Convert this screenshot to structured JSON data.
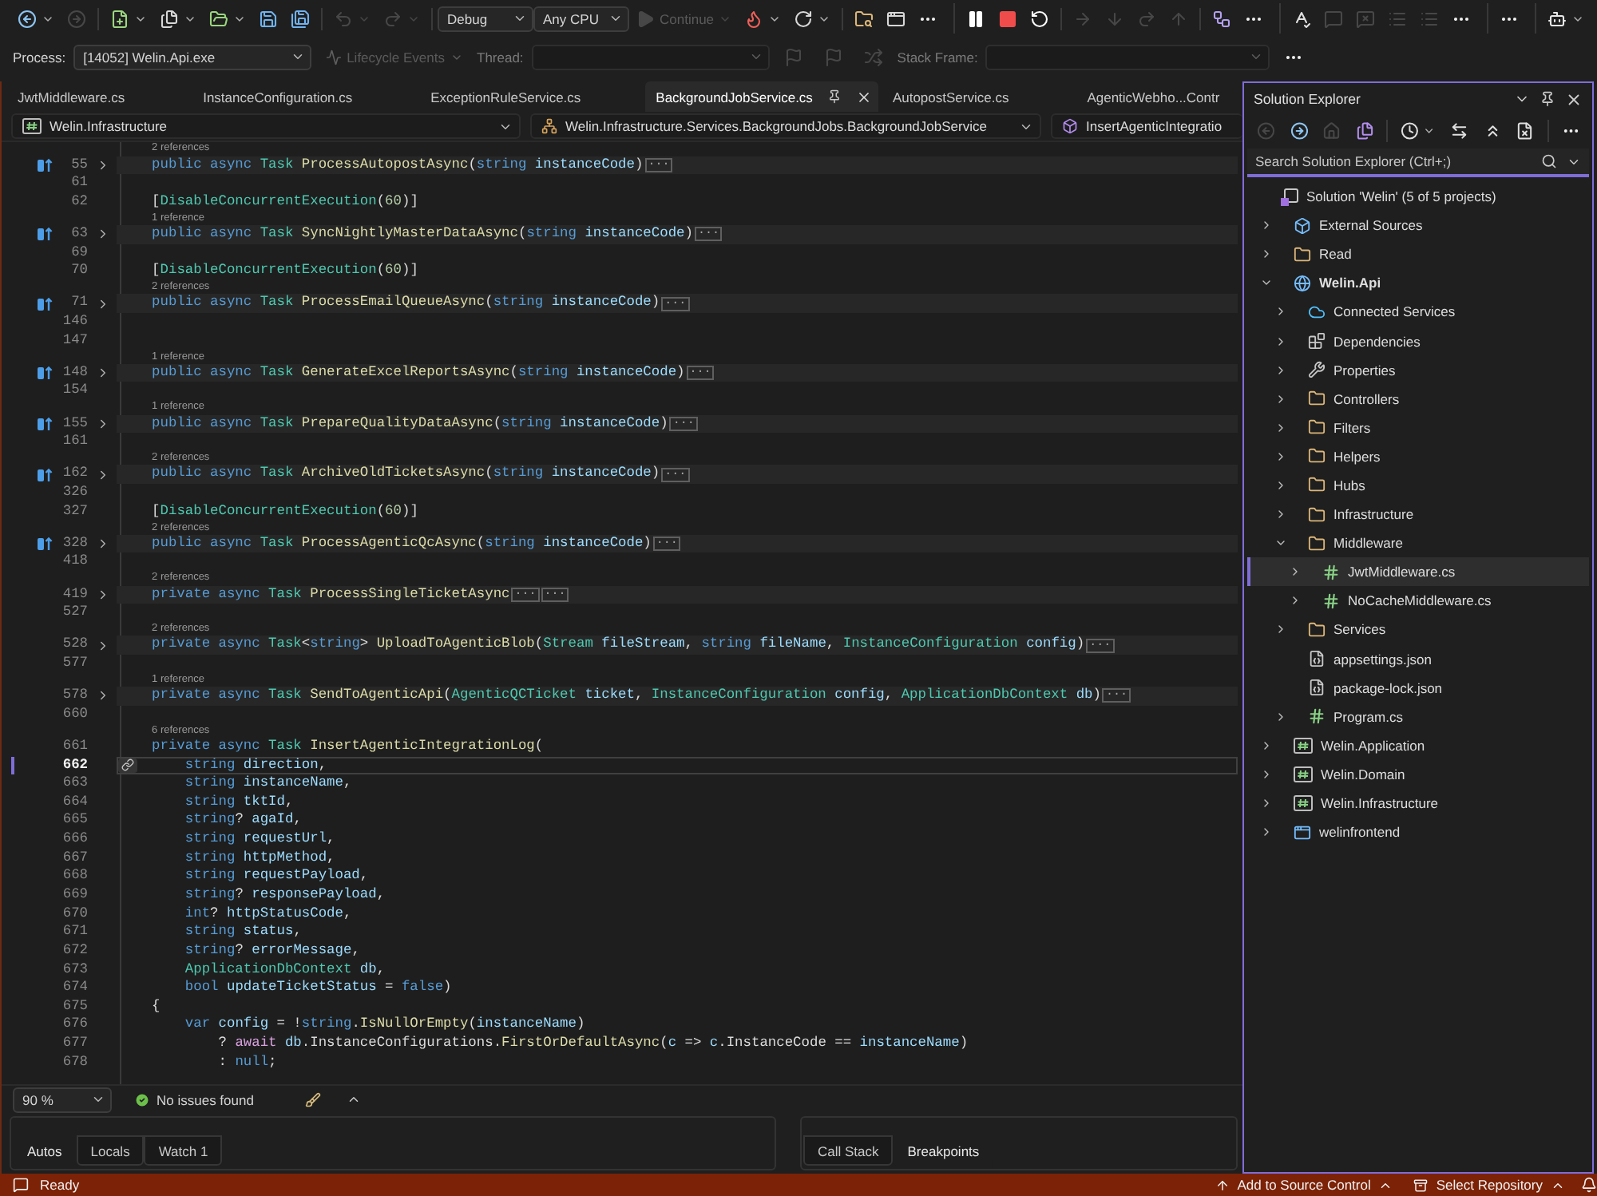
{
  "toolbar": {
    "groups": [
      {
        "items": [
          {
            "kind": "back",
            "menu": true,
            "disabled": false
          },
          {
            "kind": "forward",
            "disabled": true
          },
          {
            "kind": "separator"
          },
          {
            "kind": "new-project",
            "menu": true,
            "disabled": false
          },
          {
            "kind": "new-file",
            "menu": true,
            "disabled": false
          },
          {
            "kind": "open",
            "menu": true,
            "disabled": false
          },
          {
            "kind": "save",
            "disabled": false
          },
          {
            "kind": "save-all",
            "disabled": false
          },
          {
            "kind": "separator"
          },
          {
            "kind": "undo",
            "menu": true,
            "disabled": true
          },
          {
            "kind": "redo",
            "menu": true,
            "disabled": true
          },
          {
            "kind": "separator"
          },
          {
            "kind": "configuration",
            "value": "Debug"
          },
          {
            "kind": "platform",
            "value": "Any CPU"
          },
          {
            "kind": "continue",
            "label": "Continue",
            "menu": true,
            "disabled": true
          },
          {
            "kind": "hot-reload",
            "menu": true,
            "disabled": false
          },
          {
            "kind": "restart-app",
            "menu": true,
            "disabled": false
          },
          {
            "kind": "separator"
          },
          {
            "kind": "browse",
            "disabled": false
          },
          {
            "kind": "window",
            "disabled": false
          },
          {
            "kind": "more",
            "disabled": false
          }
        ]
      },
      {
        "items": [
          {
            "kind": "pause",
            "disabled": false
          },
          {
            "kind": "stop",
            "disabled": false
          },
          {
            "kind": "restart",
            "disabled": false
          },
          {
            "kind": "separator"
          },
          {
            "kind": "show-next",
            "disabled": true
          },
          {
            "kind": "step-into",
            "disabled": true
          },
          {
            "kind": "step-over",
            "disabled": true
          },
          {
            "kind": "step-out",
            "disabled": true
          },
          {
            "kind": "separator"
          },
          {
            "kind": "diagram",
            "disabled": false
          },
          {
            "kind": "more",
            "disabled": false
          }
        ]
      },
      {
        "items": [
          {
            "kind": "spell",
            "disabled": false
          },
          {
            "kind": "comment",
            "disabled": true
          },
          {
            "kind": "uncomment",
            "disabled": true
          },
          {
            "kind": "outdent",
            "disabled": true
          },
          {
            "kind": "indent",
            "disabled": true
          },
          {
            "kind": "more",
            "disabled": false
          }
        ]
      },
      {
        "items": [
          {
            "kind": "more",
            "disabled": false
          }
        ]
      },
      {
        "items": [
          {
            "kind": "assistant",
            "menu": true,
            "disabled": false
          }
        ]
      }
    ]
  },
  "debug_location": {
    "process_label": "Process:",
    "process": "[14052] Welin.Api.exe",
    "lifecycle": {
      "label": "Lifecycle Events",
      "disabled": true
    },
    "thread": {
      "label": "Thread:",
      "disabled": true
    },
    "flags": [
      {
        "kind": "flag",
        "disabled": true
      },
      {
        "kind": "flag-all",
        "disabled": true
      },
      {
        "kind": "crossed",
        "disabled": true
      }
    ],
    "stack_frame": {
      "label": "Stack Frame:",
      "disabled": true
    },
    "more": {
      "kind": "more",
      "disabled": false
    }
  },
  "tabs": [
    {
      "label": "JwtMiddleware.cs",
      "selected": false
    },
    {
      "label": "InstanceConfiguration.cs",
      "selected": false
    },
    {
      "label": "ExceptionRuleService.cs",
      "selected": false
    },
    {
      "label": "BackgroundJobService.cs",
      "selected": true
    },
    {
      "label": "AutopostService.cs",
      "selected": false
    },
    {
      "label": "AgenticWebho...Contr",
      "selected": false
    }
  ],
  "navigation": {
    "project": "Welin.Infrastructure",
    "type": "Welin.Infrastructure.Services.BackgroundJobs.BackgroundJobService",
    "member": "InsertAgenticIntegratio"
  },
  "editor": {
    "lines": [
      {
        "number": "55",
        "references": "2 references",
        "implements": true,
        "collapsed": true,
        "tokens": [
          {
            "kind": "keyword",
            "text": "    public async "
          },
          {
            "kind": "type",
            "text": "Task "
          },
          {
            "kind": "method",
            "text": "ProcessAutopostAsync"
          },
          {
            "kind": "plain",
            "text": "("
          },
          {
            "kind": "keyword",
            "text": "string "
          },
          {
            "kind": "param",
            "text": "instanceCode"
          },
          {
            "kind": "plain",
            "text": ")"
          },
          {
            "kind": "fold",
            "text": "..."
          }
        ]
      },
      {
        "number": "61"
      },
      {
        "number": "62",
        "tokens": [
          {
            "kind": "plain",
            "text": "    ["
          },
          {
            "kind": "type",
            "text": "DisableConcurrentExecution"
          },
          {
            "kind": "plain",
            "text": "("
          },
          {
            "kind": "number",
            "text": "60"
          },
          {
            "kind": "plain",
            "text": ")]"
          }
        ]
      },
      {
        "number": "63",
        "references": "1 reference",
        "implements": true,
        "collapsed": true,
        "tokens": [
          {
            "kind": "keyword",
            "text": "    public async "
          },
          {
            "kind": "type",
            "text": "Task "
          },
          {
            "kind": "method",
            "text": "SyncNightlyMasterDataAsync"
          },
          {
            "kind": "plain",
            "text": "("
          },
          {
            "kind": "keyword",
            "text": "string "
          },
          {
            "kind": "param",
            "text": "instanceCode"
          },
          {
            "kind": "plain",
            "text": ")"
          },
          {
            "kind": "fold",
            "text": "..."
          }
        ]
      },
      {
        "number": "69"
      },
      {
        "number": "70",
        "tokens": [
          {
            "kind": "plain",
            "text": "    ["
          },
          {
            "kind": "type",
            "text": "DisableConcurrentExecution"
          },
          {
            "kind": "plain",
            "text": "("
          },
          {
            "kind": "number",
            "text": "60"
          },
          {
            "kind": "plain",
            "text": ")]"
          }
        ]
      },
      {
        "number": "71",
        "references": "2 references",
        "implements": true,
        "collapsed": true,
        "tokens": [
          {
            "kind": "keyword",
            "text": "    public async "
          },
          {
            "kind": "type",
            "text": "Task "
          },
          {
            "kind": "method",
            "text": "ProcessEmailQueueAsync"
          },
          {
            "kind": "plain",
            "text": "("
          },
          {
            "kind": "keyword",
            "text": "string "
          },
          {
            "kind": "param",
            "text": "instanceCode"
          },
          {
            "kind": "plain",
            "text": ")"
          },
          {
            "kind": "fold",
            "text": "..."
          }
        ]
      },
      {
        "number": "146"
      },
      {
        "number": "147"
      },
      {
        "number": "148",
        "references": "1 reference",
        "implements": true,
        "collapsed": true,
        "tokens": [
          {
            "kind": "keyword",
            "text": "    public async "
          },
          {
            "kind": "type",
            "text": "Task "
          },
          {
            "kind": "method",
            "text": "GenerateExcelReportsAsync"
          },
          {
            "kind": "plain",
            "text": "("
          },
          {
            "kind": "keyword",
            "text": "string "
          },
          {
            "kind": "param",
            "text": "instanceCode"
          },
          {
            "kind": "plain",
            "text": ")"
          },
          {
            "kind": "fold",
            "text": "..."
          }
        ]
      },
      {
        "number": "154"
      },
      {
        "number": "155",
        "references": "1 reference",
        "implements": true,
        "collapsed": true,
        "tokens": [
          {
            "kind": "keyword",
            "text": "    public async "
          },
          {
            "kind": "type",
            "text": "Task "
          },
          {
            "kind": "method",
            "text": "PrepareQualityDataAsync"
          },
          {
            "kind": "plain",
            "text": "("
          },
          {
            "kind": "keyword",
            "text": "string "
          },
          {
            "kind": "param",
            "text": "instanceCode"
          },
          {
            "kind": "plain",
            "text": ")"
          },
          {
            "kind": "fold",
            "text": "..."
          }
        ]
      },
      {
        "number": "161"
      },
      {
        "number": "162",
        "references": "2 references",
        "implements": true,
        "collapsed": true,
        "tokens": [
          {
            "kind": "keyword",
            "text": "    public async "
          },
          {
            "kind": "type",
            "text": "Task "
          },
          {
            "kind": "method",
            "text": "ArchiveOldTicketsAsync"
          },
          {
            "kind": "plain",
            "text": "("
          },
          {
            "kind": "keyword",
            "text": "string "
          },
          {
            "kind": "param",
            "text": "instanceCode"
          },
          {
            "kind": "plain",
            "text": ")"
          },
          {
            "kind": "fold",
            "text": "..."
          }
        ]
      },
      {
        "number": "326"
      },
      {
        "number": "327",
        "tokens": [
          {
            "kind": "plain",
            "text": "    ["
          },
          {
            "kind": "type",
            "text": "DisableConcurrentExecution"
          },
          {
            "kind": "plain",
            "text": "("
          },
          {
            "kind": "number",
            "text": "60"
          },
          {
            "kind": "plain",
            "text": ")]"
          }
        ]
      },
      {
        "number": "328",
        "references": "2 references",
        "implements": true,
        "collapsed": true,
        "tokens": [
          {
            "kind": "keyword",
            "text": "    public async "
          },
          {
            "kind": "type",
            "text": "Task "
          },
          {
            "kind": "method",
            "text": "ProcessAgenticQcAsync"
          },
          {
            "kind": "plain",
            "text": "("
          },
          {
            "kind": "keyword",
            "text": "string "
          },
          {
            "kind": "param",
            "text": "instanceCode"
          },
          {
            "kind": "plain",
            "text": ")"
          },
          {
            "kind": "fold",
            "text": "..."
          }
        ]
      },
      {
        "number": "418"
      },
      {
        "number": "419",
        "references": "2 references",
        "collapsed": true,
        "tokens": [
          {
            "kind": "keyword",
            "text": "    private async "
          },
          {
            "kind": "type",
            "text": "Task "
          },
          {
            "kind": "method",
            "text": "ProcessSingleTicketAsync"
          },
          {
            "kind": "fold",
            "text": "..."
          },
          {
            "kind": "fold",
            "text": "..."
          }
        ]
      },
      {
        "number": "527"
      },
      {
        "number": "528",
        "references": "2 references",
        "collapsed": true,
        "tokens": [
          {
            "kind": "keyword",
            "text": "    private async "
          },
          {
            "kind": "type",
            "text": "Task"
          },
          {
            "kind": "plain",
            "text": "<"
          },
          {
            "kind": "keyword",
            "text": "string"
          },
          {
            "kind": "plain",
            "text": "> "
          },
          {
            "kind": "method",
            "text": "UploadToAgenticBlob"
          },
          {
            "kind": "plain",
            "text": "("
          },
          {
            "kind": "type",
            "text": "Stream "
          },
          {
            "kind": "param",
            "text": "fileStream"
          },
          {
            "kind": "plain",
            "text": ", "
          },
          {
            "kind": "keyword",
            "text": "string "
          },
          {
            "kind": "param",
            "text": "fileName"
          },
          {
            "kind": "plain",
            "text": ", "
          },
          {
            "kind": "type",
            "text": "InstanceConfiguration "
          },
          {
            "kind": "param",
            "text": "config"
          },
          {
            "kind": "plain",
            "text": ")"
          },
          {
            "kind": "fold",
            "text": "..."
          }
        ]
      },
      {
        "number": "577"
      },
      {
        "number": "578",
        "references": "1 reference",
        "collapsed": true,
        "tokens": [
          {
            "kind": "keyword",
            "text": "    private async "
          },
          {
            "kind": "type",
            "text": "Task "
          },
          {
            "kind": "method",
            "text": "SendToAgenticApi"
          },
          {
            "kind": "plain",
            "text": "("
          },
          {
            "kind": "type",
            "text": "AgenticQCTicket "
          },
          {
            "kind": "param",
            "text": "ticket"
          },
          {
            "kind": "plain",
            "text": ", "
          },
          {
            "kind": "type",
            "text": "InstanceConfiguration "
          },
          {
            "kind": "param",
            "text": "config"
          },
          {
            "kind": "plain",
            "text": ", "
          },
          {
            "kind": "type",
            "text": "ApplicationDbContext "
          },
          {
            "kind": "param",
            "text": "db"
          },
          {
            "kind": "plain",
            "text": ")"
          },
          {
            "kind": "fold",
            "text": "..."
          }
        ]
      },
      {
        "number": "660"
      },
      {
        "number": "661",
        "references": "6 references",
        "tokens": [
          {
            "kind": "keyword",
            "text": "    private async "
          },
          {
            "kind": "type",
            "text": "Task "
          },
          {
            "kind": "method",
            "text": "InsertAgenticIntegrationLog"
          },
          {
            "kind": "plain",
            "text": "("
          }
        ]
      },
      {
        "number": "662",
        "current": true,
        "tokens": [
          {
            "kind": "keyword",
            "text": "        string "
          },
          {
            "kind": "param",
            "text": "direction"
          },
          {
            "kind": "plain",
            "text": ","
          }
        ]
      },
      {
        "number": "663",
        "tokens": [
          {
            "kind": "keyword",
            "text": "        string "
          },
          {
            "kind": "param",
            "text": "instanceName"
          },
          {
            "kind": "plain",
            "text": ","
          }
        ]
      },
      {
        "number": "664",
        "tokens": [
          {
            "kind": "keyword",
            "text": "        string "
          },
          {
            "kind": "param",
            "text": "tktId"
          },
          {
            "kind": "plain",
            "text": ","
          }
        ]
      },
      {
        "number": "665",
        "tokens": [
          {
            "kind": "keyword",
            "text": "        string"
          },
          {
            "kind": "plain",
            "text": "? "
          },
          {
            "kind": "param",
            "text": "agaId"
          },
          {
            "kind": "plain",
            "text": ","
          }
        ]
      },
      {
        "number": "666",
        "tokens": [
          {
            "kind": "keyword",
            "text": "        string "
          },
          {
            "kind": "param",
            "text": "requestUrl"
          },
          {
            "kind": "plain",
            "text": ","
          }
        ]
      },
      {
        "number": "667",
        "tokens": [
          {
            "kind": "keyword",
            "text": "        string "
          },
          {
            "kind": "param",
            "text": "httpMethod"
          },
          {
            "kind": "plain",
            "text": ","
          }
        ]
      },
      {
        "number": "668",
        "tokens": [
          {
            "kind": "keyword",
            "text": "        string "
          },
          {
            "kind": "param",
            "text": "requestPayload"
          },
          {
            "kind": "plain",
            "text": ","
          }
        ]
      },
      {
        "number": "669",
        "tokens": [
          {
            "kind": "keyword",
            "text": "        string"
          },
          {
            "kind": "plain",
            "text": "? "
          },
          {
            "kind": "param",
            "text": "responsePayload"
          },
          {
            "kind": "plain",
            "text": ","
          }
        ]
      },
      {
        "number": "670",
        "tokens": [
          {
            "kind": "keyword",
            "text": "        int"
          },
          {
            "kind": "plain",
            "text": "? "
          },
          {
            "kind": "param",
            "text": "httpStatusCode"
          },
          {
            "kind": "plain",
            "text": ","
          }
        ]
      },
      {
        "number": "671",
        "tokens": [
          {
            "kind": "keyword",
            "text": "        string "
          },
          {
            "kind": "param",
            "text": "status"
          },
          {
            "kind": "plain",
            "text": ","
          }
        ]
      },
      {
        "number": "672",
        "tokens": [
          {
            "kind": "keyword",
            "text": "        string"
          },
          {
            "kind": "plain",
            "text": "? "
          },
          {
            "kind": "param",
            "text": "errorMessage"
          },
          {
            "kind": "plain",
            "text": ","
          }
        ]
      },
      {
        "number": "673",
        "tokens": [
          {
            "kind": "type",
            "text": "        ApplicationDbContext "
          },
          {
            "kind": "param",
            "text": "db"
          },
          {
            "kind": "plain",
            "text": ","
          }
        ]
      },
      {
        "number": "674",
        "tokens": [
          {
            "kind": "keyword",
            "text": "        bool "
          },
          {
            "kind": "param",
            "text": "updateTicketStatus"
          },
          {
            "kind": "plain",
            "text": " = "
          },
          {
            "kind": "keyword",
            "text": "false"
          },
          {
            "kind": "plain",
            "text": ")"
          }
        ]
      },
      {
        "number": "675",
        "tokens": [
          {
            "kind": "plain",
            "text": "    {"
          }
        ]
      },
      {
        "number": "676",
        "tokens": [
          {
            "kind": "keyword",
            "text": "        var "
          },
          {
            "kind": "local",
            "text": "config"
          },
          {
            "kind": "plain",
            "text": " = !"
          },
          {
            "kind": "keyword",
            "text": "string"
          },
          {
            "kind": "plain",
            "text": "."
          },
          {
            "kind": "method",
            "text": "IsNullOrEmpty"
          },
          {
            "kind": "plain",
            "text": "("
          },
          {
            "kind": "param",
            "text": "instanceName"
          },
          {
            "kind": "plain",
            "text": ")"
          }
        ]
      },
      {
        "number": "677",
        "tokens": [
          {
            "kind": "plain",
            "text": "            ? "
          },
          {
            "kind": "control",
            "text": "await "
          },
          {
            "kind": "param",
            "text": "db"
          },
          {
            "kind": "plain",
            "text": "."
          },
          {
            "kind": "property",
            "text": "InstanceConfigurations"
          },
          {
            "kind": "plain",
            "text": "."
          },
          {
            "kind": "method",
            "text": "FirstOrDefaultAsync"
          },
          {
            "kind": "plain",
            "text": "("
          },
          {
            "kind": "param",
            "text": "c"
          },
          {
            "kind": "plain",
            "text": " => "
          },
          {
            "kind": "param",
            "text": "c"
          },
          {
            "kind": "plain",
            "text": "."
          },
          {
            "kind": "property",
            "text": "InstanceCode"
          },
          {
            "kind": "plain",
            "text": " == "
          },
          {
            "kind": "param",
            "text": "instanceName"
          },
          {
            "kind": "plain",
            "text": ")"
          }
        ]
      },
      {
        "number": "678",
        "tokens": [
          {
            "kind": "plain",
            "text": "            : "
          },
          {
            "kind": "keyword",
            "text": "null"
          },
          {
            "kind": "plain",
            "text": ";"
          }
        ]
      }
    ]
  },
  "editor_status": {
    "zoom": "90 %",
    "issues": "No issues found"
  },
  "tool_panels": [
    {
      "tabs": [
        {
          "label": "Autos",
          "selected": true
        },
        {
          "label": "Locals",
          "selected": false
        },
        {
          "label": "Watch 1",
          "selected": false
        }
      ]
    },
    {
      "tabs": [
        {
          "label": "Call Stack",
          "selected": false
        },
        {
          "label": "Breakpoints",
          "selected": true
        }
      ]
    }
  ],
  "solution_explorer": {
    "title": "Solution Explorer",
    "toolbar": [
      {
        "kind": "back",
        "disabled": true
      },
      {
        "kind": "forward",
        "disabled": false
      },
      {
        "kind": "home",
        "disabled": true
      },
      {
        "kind": "sync",
        "disabled": false
      },
      {
        "kind": "separator"
      },
      {
        "kind": "history",
        "menu": true,
        "disabled": false
      },
      {
        "kind": "switch-view",
        "disabled": false
      },
      {
        "kind": "collapse",
        "disabled": false
      },
      {
        "kind": "show-all",
        "disabled": false
      },
      {
        "kind": "separator"
      },
      {
        "kind": "more",
        "disabled": false
      }
    ],
    "search": {
      "placeholder": "Search Solution Explorer (Ctrl+;)"
    },
    "tree": {
      "label": "Solution 'Welin' (5 of 5 projects)",
      "kind": "solution",
      "selected": false,
      "children": [
        {
          "label": "External Sources",
          "kind": "external",
          "expanded": false,
          "selected": false
        },
        {
          "label": "Read",
          "kind": "folder",
          "expanded": false,
          "selected": false
        },
        {
          "label": "Welin.Api",
          "kind": "web-project",
          "expanded": true,
          "startup": true,
          "selected": false,
          "children": [
            {
              "label": "Connected Services",
              "kind": "connected",
              "expanded": false,
              "selected": false
            },
            {
              "label": "Dependencies",
              "kind": "dependencies",
              "expanded": false,
              "selected": false
            },
            {
              "label": "Properties",
              "kind": "properties",
              "expanded": false,
              "selected": false
            },
            {
              "label": "Controllers",
              "kind": "folder",
              "expanded": false,
              "selected": false
            },
            {
              "label": "Filters",
              "kind": "folder",
              "expanded": false,
              "selected": false
            },
            {
              "label": "Helpers",
              "kind": "folder",
              "expanded": false,
              "selected": false
            },
            {
              "label": "Hubs",
              "kind": "folder",
              "expanded": false,
              "selected": false
            },
            {
              "label": "Infrastructure",
              "kind": "folder",
              "expanded": false,
              "selected": false
            },
            {
              "label": "Middleware",
              "kind": "folder",
              "expanded": true,
              "selected": false,
              "children": [
                {
                  "label": "JwtMiddleware.cs",
                  "kind": "csharp",
                  "expanded": false,
                  "selected": true
                },
                {
                  "label": "NoCacheMiddleware.cs",
                  "kind": "csharp",
                  "expanded": false,
                  "selected": false
                }
              ]
            },
            {
              "label": "Services",
              "kind": "folder",
              "expanded": false,
              "selected": false
            },
            {
              "label": "appsettings.json",
              "kind": "json",
              "selected": false
            },
            {
              "label": "package-lock.json",
              "kind": "json",
              "selected": false
            },
            {
              "label": "Program.cs",
              "kind": "csharp",
              "expanded": false,
              "selected": false
            }
          ]
        },
        {
          "label": "Welin.Application",
          "kind": "project",
          "expanded": false,
          "selected": false
        },
        {
          "label": "Welin.Domain",
          "kind": "project",
          "expanded": false,
          "selected": false
        },
        {
          "label": "Welin.Infrastructure",
          "kind": "project",
          "expanded": false,
          "selected": false
        },
        {
          "label": "welinfrontend",
          "kind": "frontend",
          "expanded": false,
          "selected": false
        }
      ]
    }
  },
  "status_bar": {
    "status": "Ready",
    "source_control": "Add to Source Control",
    "repository": "Select Repository"
  }
}
